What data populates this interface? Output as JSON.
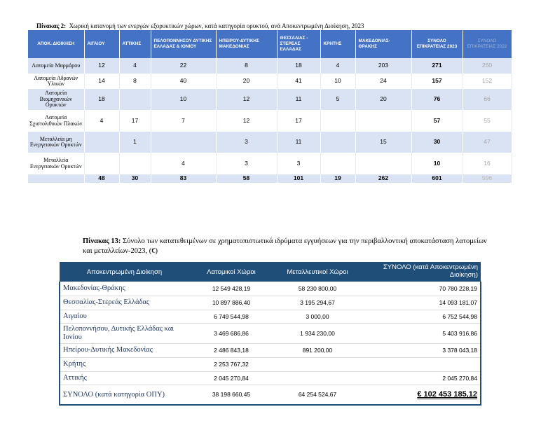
{
  "table2": {
    "caption_label": "Πίνακας 2:",
    "caption_text": "Χωρική κατανομή των ενεργών εξορυκτικών χώρων, κατά κατηγορία ορυκτού, ανά Αποκεντρωμένη Διοίκηση, 2023",
    "headers": [
      "ΑΠΟΚ. ΔΙΟΙΚΗΣΗ",
      "ΑΙΓΑΙΟΥ",
      "ΑΤΤΙΚΗΣ",
      "ΠΕΛΟΠΟΝΝΗΣΟΥ ΔΥΤΙΚΗΣ ΕΛΛΑΔΑΣ & ΙΟΝΙΟΥ",
      "ΗΠΕΙΡΟΥ-ΔΥΤΙΚΗΣ ΜΑΚΕΔΟΝΙΑΣ",
      "ΘΕΣΣΑΛΙΑΣ - ΣΤΕΡΕΑΣ ΕΛΛΑΔΑΣ",
      "ΚΡΗΤΗΣ",
      "ΜΑΚΕΔΟΝΙΑΣ-ΘΡΑΚΗΣ",
      "ΣΥΝΟΛΟ ΕΠΙΚΡΑΤΕΙΑΣ 2023",
      "ΣΥΝΟΛΟ ΕΠΙΚΡΑΤΕΙΑΣ 2022"
    ],
    "rows": [
      {
        "label": "Λατομεία Μαρμάρου",
        "cells": [
          "12",
          "4",
          "22",
          "8",
          "18",
          "4",
          "203",
          "271",
          "260"
        ]
      },
      {
        "label": "Λατομεία Αδρανών Υλικών",
        "cells": [
          "14",
          "8",
          "40",
          "20",
          "41",
          "10",
          "24",
          "157",
          "152"
        ]
      },
      {
        "label": "Λατομεία Βιομηχανικών Ορυκτών",
        "cells": [
          "18",
          "",
          "10",
          "12",
          "11",
          "5",
          "20",
          "76",
          "66"
        ]
      },
      {
        "label": "Λατομεία Σχιστολιθικών Πλακών",
        "cells": [
          "4",
          "17",
          "7",
          "12",
          "17",
          "",
          "",
          "57",
          "55"
        ]
      },
      {
        "label": "Μεταλλεία μη Ενεργειακών Ορυκτών",
        "cells": [
          "",
          "1",
          "",
          "3",
          "11",
          "",
          "15",
          "30",
          "47"
        ]
      },
      {
        "label": "Μεταλλεία Ενεργειακών Ορυκτών",
        "cells": [
          "",
          "",
          "4",
          "3",
          "3",
          "",
          "",
          "10",
          "16"
        ]
      }
    ],
    "totals": [
      "",
      "48",
      "30",
      "83",
      "58",
      "101",
      "19",
      "262",
      "601",
      "596"
    ]
  },
  "table13": {
    "caption_label": "Πίνακας 13:",
    "caption_text": "Σύνολο των κατατεθειμένων σε χρηματοπιστωτικά ιδρύματα εγγυήσεων για την περιβαλλοντική αποκατάσταση λατομείων και μεταλλείων-2023, (€)",
    "headers": [
      "Αποκεντρωμένη Διοίκηση",
      "Λατομικοί Χώροι",
      "Μεταλλευτικοί Χώροι",
      "ΣΥΝΟΛΟ (κατά Αποκεντρωμένη Διοίκηση)"
    ],
    "rows": [
      {
        "label": "Μακεδονίας-Θράκης",
        "quarry": "12 549 428,19",
        "mine": "58 230 800,00",
        "total": "70 780 228,19"
      },
      {
        "label": "Θεσσαλίας-Στερεάς Ελλάδας",
        "quarry": "10 897 886,40",
        "mine": "3 195 294,67",
        "total": "14 093 181,07"
      },
      {
        "label": "Αιγαίου",
        "quarry": "6 749 544,98",
        "mine": "3 000,00",
        "total": "6 752 544,98"
      },
      {
        "label": "Πελοποννήσου, Δυτικής Ελλάδας και Ιονίου",
        "quarry": "3 469 686,86",
        "mine": "1 934 230,00",
        "total": "5 403 916,86"
      },
      {
        "label": "Ηπείρου-Δυτικής Μακεδονίας",
        "quarry": "2 486 843,18",
        "mine": "891 200,00",
        "total": "3 378 043,18"
      },
      {
        "label": "Κρήτης",
        "quarry": "2 253 767,32",
        "mine": "",
        "total": ""
      },
      {
        "label": "Αττικής",
        "quarry": "2 045 270,84",
        "mine": "",
        "total": "2 045 270,84"
      }
    ],
    "total_row": {
      "label": "ΣΥΝΟΛΟ (κατά κατηγορία ΟΠΥ)",
      "quarry": "38 198 660,45",
      "mine": "64 254 524,67",
      "total": "€ 102 453 185,12"
    }
  }
}
